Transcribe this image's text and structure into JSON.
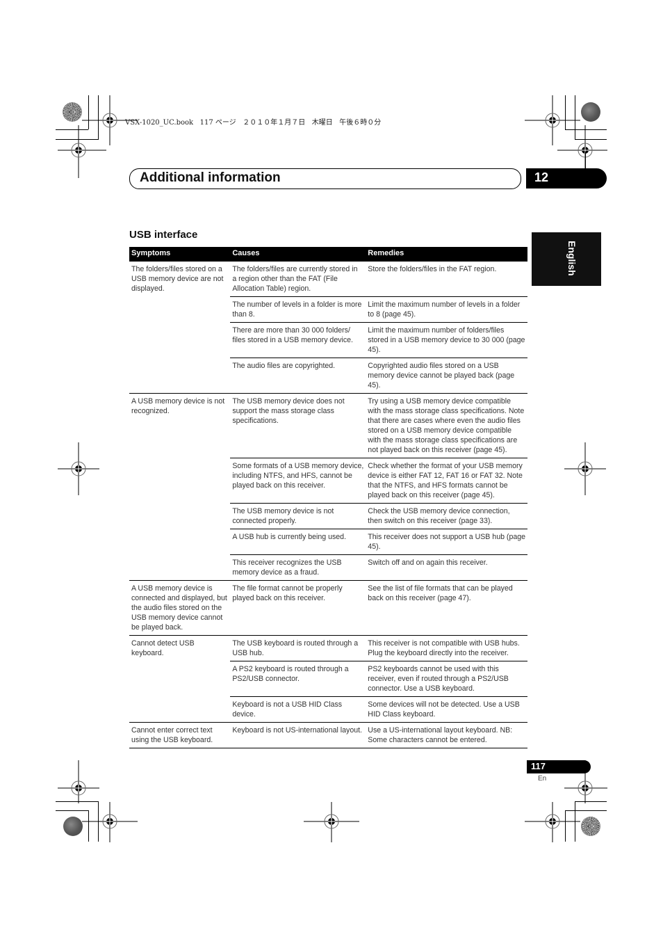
{
  "print_header": {
    "file_info": "VSX-1020_UC.book   117 ページ   ２０１０年１月７日   木曜日   午後６時０分"
  },
  "chapter": {
    "title": "Additional information",
    "number": "12"
  },
  "language_tab": "English",
  "section": {
    "title": "USB interface",
    "table": {
      "headers": [
        "Symptoms",
        "Causes",
        "Remedies"
      ],
      "groups": [
        {
          "symptom": "The folders/files stored on a USB memory device are not displayed.",
          "rows": [
            {
              "cause": "The folders/files are currently stored in a region other than the FAT (File Allocation Table) region.",
              "remedy": "Store the folders/files in the FAT region."
            },
            {
              "cause": "The number of levels in a folder is more than 8.",
              "remedy": "Limit the maximum number of levels in a folder to 8 (page 45)."
            },
            {
              "cause": "There are more than 30 000 folders/ files stored in a USB memory device.",
              "remedy": "Limit the maximum number of folders/files stored in a USB memory device to 30 000 (page 45)."
            },
            {
              "cause": "The audio files are copyrighted.",
              "remedy": "Copyrighted audio files stored on a USB memory device cannot be played back (page 45)."
            }
          ]
        },
        {
          "symptom": "A USB memory device is not recognized.",
          "rows": [
            {
              "cause": "The USB memory device does not support the mass storage class specifications.",
              "remedy": "Try using a USB memory device compatible with the mass storage class specifications. Note that there are cases where even the audio files stored on a USB memory device compatible with the mass storage class specifications are not played back on this receiver (page 45)."
            },
            {
              "cause": "Some formats of a USB memory device, including NTFS, and HFS, cannot be played back on this receiver.",
              "remedy": "Check whether the format of your USB memory device is either FAT 12, FAT 16 or FAT 32. Note that the NTFS, and HFS formats cannot be played back on this receiver (page 45)."
            },
            {
              "cause": "The USB memory device is not connected properly.",
              "remedy": "Check the USB memory device connection, then switch on this receiver (page 33)."
            },
            {
              "cause": "A USB hub is currently being used.",
              "remedy": "This receiver does not support a USB hub (page 45)."
            },
            {
              "cause": "This receiver recognizes the USB memory device as a fraud.",
              "remedy": "Switch off and on again this receiver."
            }
          ]
        },
        {
          "symptom": "A USB memory device is connected and displayed, but the audio files stored on the USB memory device cannot be played back.",
          "rows": [
            {
              "cause": "The file format cannot be properly played back on this receiver.",
              "remedy": "See the list of file formats that can be played back on this receiver (page 47)."
            }
          ]
        },
        {
          "symptom": "Cannot detect USB keyboard.",
          "rows": [
            {
              "cause": "The USB keyboard is routed through a USB hub.",
              "remedy": "This receiver is not compatible with USB hubs. Plug the keyboard directly into the receiver."
            },
            {
              "cause": "A PS2 keyboard is routed through a PS2/USB connector.",
              "remedy": "PS2 keyboards cannot be used with this receiver, even if routed through a PS2/USB connector. Use a USB keyboard."
            },
            {
              "cause": "Keyboard is not a USB HID Class device.",
              "remedy": "Some devices will not be detected. Use a USB HID Class keyboard."
            }
          ]
        },
        {
          "symptom": "Cannot enter correct text using the USB keyboard.",
          "rows": [
            {
              "cause": "Keyboard is not US-international layout.",
              "remedy": "Use a US-international layout keyboard. NB: Some characters cannot be entered."
            }
          ]
        }
      ]
    }
  },
  "footer": {
    "page_number": "117",
    "page_lang": "En"
  },
  "colors": {
    "ink": "#000000",
    "text": "#333333",
    "paper": "#ffffff"
  }
}
